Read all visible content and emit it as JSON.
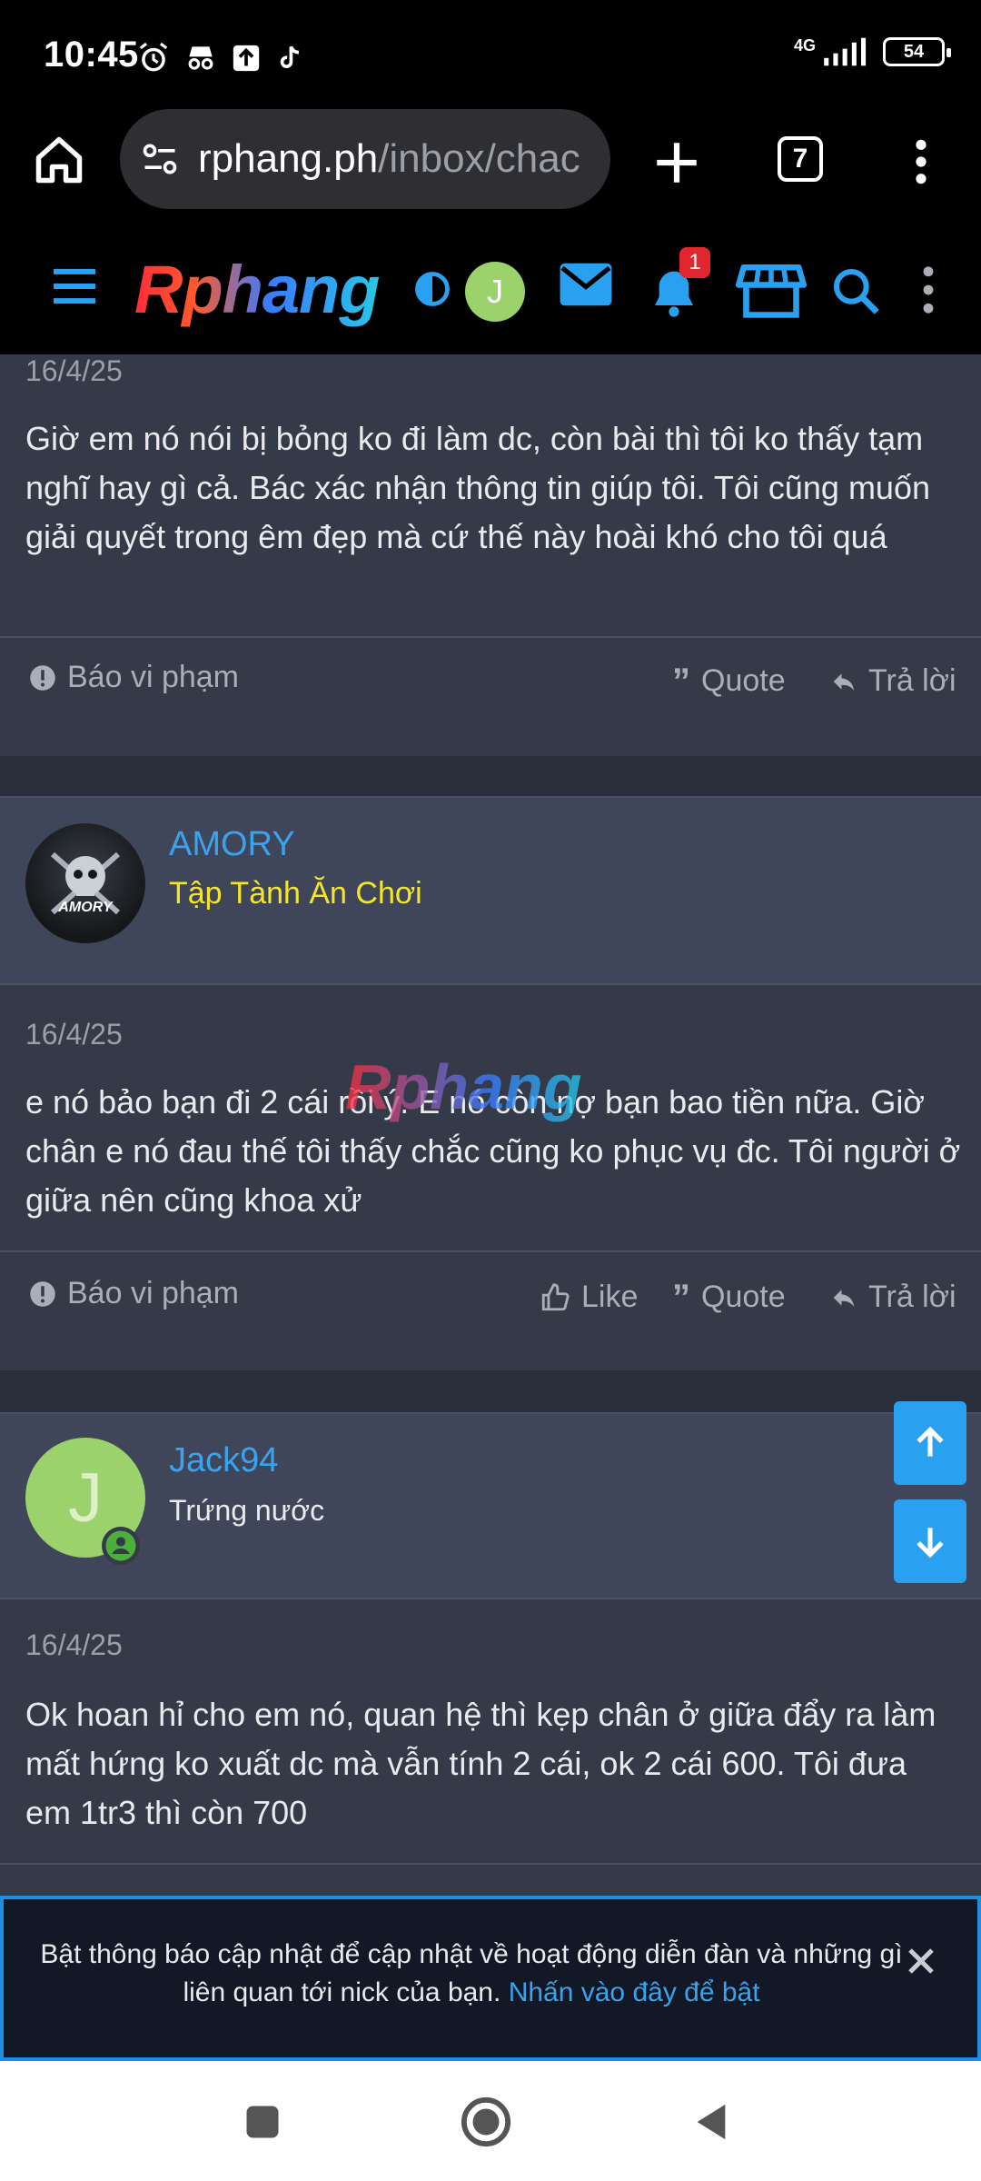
{
  "status_bar": {
    "time": "10:45",
    "network": "4G",
    "battery": "54"
  },
  "browser": {
    "url_host": "rphang.ph",
    "url_path": "/inbox/chac",
    "tab_count": "7"
  },
  "site": {
    "logo": "Rphang",
    "avatar_letter": "J",
    "notification_count": "1"
  },
  "posts": [
    {
      "date": "16/4/25",
      "body": "Giờ em nó nói bị bỏng ko đi làm dc, còn bài thì tôi ko thấy tạm nghĩ hay gì cả. Bác xác nhận thông tin giúp tôi. Tôi cũng muốn giải quyết trong êm đẹp mà cứ thế này hoài khó cho tôi quá",
      "report": "Báo vi phạm",
      "quote": "Quote",
      "reply": "Trả lời"
    },
    {
      "author": "AMORY",
      "user_title": "Tập Tành Ăn Chơi",
      "avatar_text": "AMORY",
      "date": "16/4/25",
      "body": "e nó bảo bạn đi 2 cái rồi ý. E nó còn nợ bạn bao tiền nữa. Giờ chân e nó đau thế tôi thấy chắc cũng ko phục vụ đc. Tôi người ở giữa nên cũng khoa xử",
      "report": "Báo vi phạm",
      "like": "Like",
      "quote": "Quote",
      "reply": "Trả lời"
    },
    {
      "author": "Jack94",
      "user_title": "Trứng nước",
      "avatar_letter": "J",
      "date": "16/4/25",
      "body": "Ok hoan hỉ cho em nó, quan hệ thì kẹp chân ở giữa đẩy ra làm mất hứng ko xuất dc mà vẫn tính 2 cái, ok 2 cái 600. Tôi đưa em 1tr3 thì còn 700"
    }
  ],
  "watermark": "Rphang",
  "notification_banner": {
    "text": "Bật thông báo cập nhật để cập nhật về hoạt động diễn đàn và những gì liên quan tới nick của bạn.",
    "link": "Nhấn vào đây để bật"
  },
  "colors": {
    "accent": "#2aa1f0",
    "link": "#3ba3ee",
    "user_title_yellow": "#f5e62c",
    "card_bg": "#353a48",
    "header_bg": "#404659"
  }
}
